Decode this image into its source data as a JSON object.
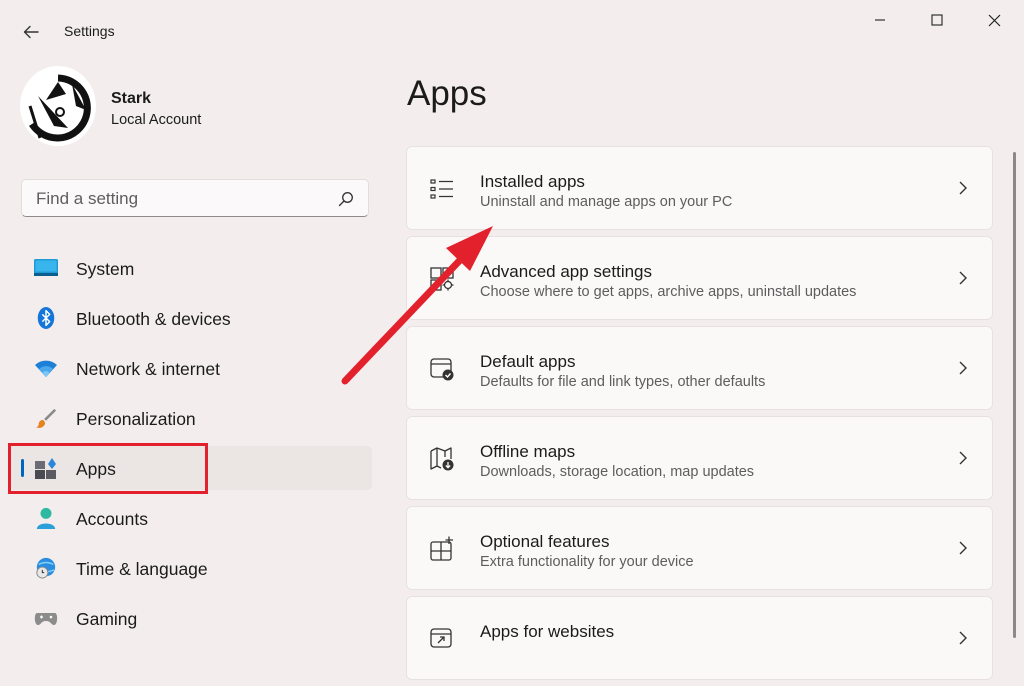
{
  "window": {
    "title": "Settings",
    "controls": [
      "minimize",
      "maximize",
      "close"
    ]
  },
  "profile": {
    "name": "Stark",
    "account_type": "Local Account"
  },
  "search": {
    "placeholder": "Find a setting"
  },
  "sidebar": {
    "items": [
      {
        "label": "System",
        "icon": "system-icon",
        "active": false
      },
      {
        "label": "Bluetooth & devices",
        "icon": "bluetooth-icon",
        "active": false
      },
      {
        "label": "Network & internet",
        "icon": "wifi-icon",
        "active": false
      },
      {
        "label": "Personalization",
        "icon": "brush-icon",
        "active": false
      },
      {
        "label": "Apps",
        "icon": "apps-icon",
        "active": true
      },
      {
        "label": "Accounts",
        "icon": "person-icon",
        "active": false
      },
      {
        "label": "Time & language",
        "icon": "globe-clock-icon",
        "active": false
      },
      {
        "label": "Gaming",
        "icon": "gamepad-icon",
        "active": false
      }
    ]
  },
  "main": {
    "title": "Apps",
    "cards": [
      {
        "title": "Installed apps",
        "subtitle": "Uninstall and manage apps on your PC",
        "icon": "list-icon"
      },
      {
        "title": "Advanced app settings",
        "subtitle": "Choose where to get apps, archive apps, uninstall updates",
        "icon": "grid-gear-icon"
      },
      {
        "title": "Default apps",
        "subtitle": "Defaults for file and link types, other defaults",
        "icon": "window-check-icon"
      },
      {
        "title": "Offline maps",
        "subtitle": "Downloads, storage location, map updates",
        "icon": "map-download-icon"
      },
      {
        "title": "Optional features",
        "subtitle": "Extra functionality for your device",
        "icon": "grid-plus-icon"
      },
      {
        "title": "Apps for websites",
        "subtitle": "",
        "icon": "window-link-icon"
      }
    ]
  },
  "colors": {
    "background": "#f3eeed",
    "accent": "#0067c0",
    "annotation_red": "#e3212d"
  }
}
